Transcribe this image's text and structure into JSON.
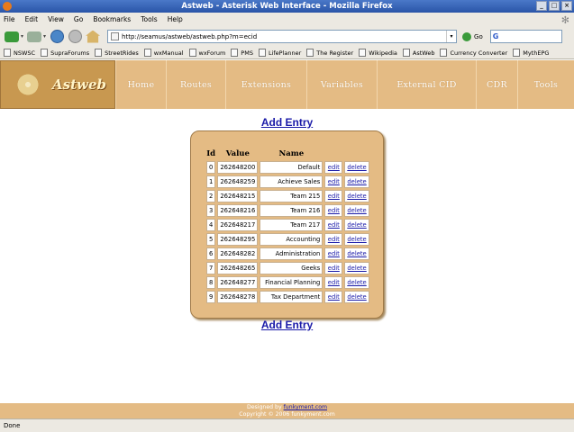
{
  "window": {
    "title": "Astweb - Asterisk Web Interface - Mozilla Firefox"
  },
  "menu": [
    "File",
    "Edit",
    "View",
    "Go",
    "Bookmarks",
    "Tools",
    "Help"
  ],
  "navbar": {
    "url": "http://seamus/astweb/astweb.php?m=ecid",
    "go_label": "Go"
  },
  "bookmarks": [
    "NSWSC",
    "SupraForums",
    "StreetRides",
    "wxManual",
    "wxForum",
    "PMS",
    "LifePlanner",
    "The Register",
    "Wikipedia",
    "AstWeb",
    "Currency Converter",
    "MythEPG"
  ],
  "app": {
    "logo_text": "Astweb",
    "nav": [
      "Home",
      "Routes",
      "Extensions",
      "Variables",
      "External CID",
      "CDR",
      "Tools"
    ]
  },
  "content": {
    "add_entry_label": "Add Entry",
    "columns": {
      "id": "Id",
      "value": "Value",
      "name": "Name"
    },
    "edit_label": "edit",
    "delete_label": "delete",
    "rows": [
      {
        "id": "0",
        "value": "262648200",
        "name": "Default"
      },
      {
        "id": "1",
        "value": "262648259",
        "name": "Achieve Sales"
      },
      {
        "id": "2",
        "value": "262648215",
        "name": "Team 215"
      },
      {
        "id": "3",
        "value": "262648216",
        "name": "Team 216"
      },
      {
        "id": "4",
        "value": "262648217",
        "name": "Team 217"
      },
      {
        "id": "5",
        "value": "262648295",
        "name": "Accounting"
      },
      {
        "id": "6",
        "value": "262648282",
        "name": "Administration"
      },
      {
        "id": "7",
        "value": "262648265",
        "name": "Geeks"
      },
      {
        "id": "8",
        "value": "262648277",
        "name": "Financial Planning"
      },
      {
        "id": "9",
        "value": "262648278",
        "name": "Tax Department"
      }
    ]
  },
  "footer": {
    "designed_by": "Designed by",
    "designer_link": "funkyment.com",
    "copyright": "Copyright © 2006 funkyment.com"
  },
  "status": {
    "text": "Done"
  },
  "colors": {
    "accent": "#e4bb84",
    "link": "#1a1aa8"
  }
}
